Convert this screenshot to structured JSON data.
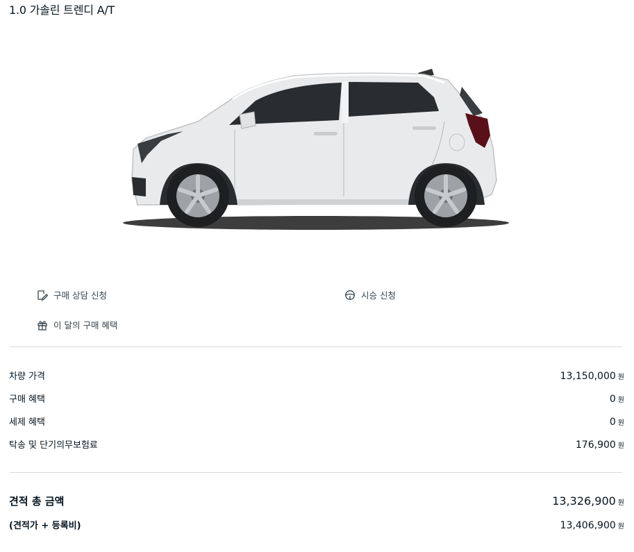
{
  "trim_title": "1.0 가솔린 트렌디 A/T",
  "actions": {
    "consult": "구매 상담 신청",
    "test_drive": "시승 신청",
    "monthly_benefit": "이 달의 구매 혜택"
  },
  "price_rows": [
    {
      "label": "차량 가격",
      "value": "13,150,000",
      "unit": "원"
    },
    {
      "label": "구매 혜택",
      "value": "0",
      "unit": "원"
    },
    {
      "label": "세제 혜택",
      "value": "0",
      "unit": "원"
    },
    {
      "label": "탁송 및 단기의무보험료",
      "value": "176,900",
      "unit": "원"
    }
  ],
  "total": {
    "label": "견적 총 금액",
    "value": "13,326,900",
    "unit": "원"
  },
  "registration_total": {
    "label": "(견적가 + 등록비)",
    "value": "13,406,900",
    "unit": "원"
  },
  "colors": {
    "text": "#05141f",
    "muted": "#37434c",
    "divider": "#d9dadb",
    "car_body": "#e9eaeb"
  }
}
